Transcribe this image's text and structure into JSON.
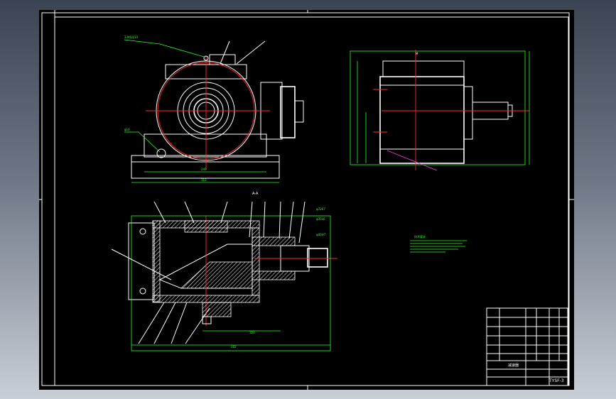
{
  "drawing": {
    "sheet_number": "TYSF-3",
    "title_block_label": "减速器",
    "section_label": "A-A"
  },
  "colors": {
    "background": "#000000",
    "outline": "#ffffff",
    "dimension": "#24ff24",
    "centerline": "#ff2a2a",
    "leader": "#ffe600",
    "hidden": "#ff3cff"
  }
}
